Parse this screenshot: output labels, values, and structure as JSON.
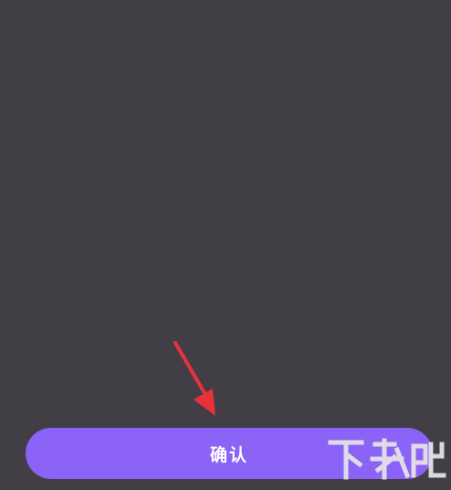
{
  "dialog": {
    "confirm_label": "确认"
  },
  "colors": {
    "background": "#413e45",
    "button": "#8b63f6",
    "button_text": "#ffffff",
    "arrow": "#e8323a"
  },
  "annotation": {
    "arrow_icon": "red-arrow-icon"
  },
  "watermark": {
    "text": "下载吧"
  }
}
